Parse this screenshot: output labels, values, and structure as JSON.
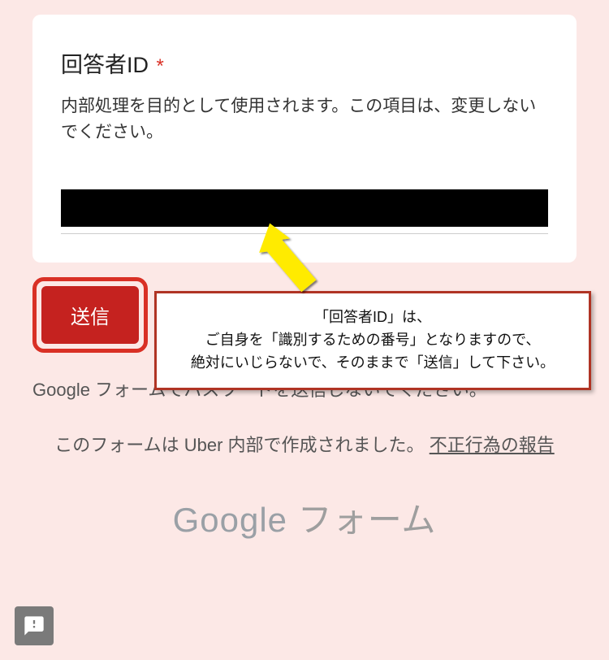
{
  "card": {
    "title": "回答者ID",
    "required_mark": "*",
    "description": "内部処理を目的として使用されます。この項目は、変更しないでください。"
  },
  "submit": {
    "label": "送信"
  },
  "callout": {
    "line1": "「回答者ID」は、",
    "line2": "ご自身を「識別するための番号」となりますので、",
    "line3": "絶対にいじらないで、そのままで「送信」して下さい。"
  },
  "footer": {
    "warning": "Google フォームでパスワードを送信しないでください。",
    "origin_prefix": "このフォームは Uber 内部で作成されました。",
    "report_link": "不正行為の報告",
    "logo_google": "Google",
    "logo_forms": " フォーム"
  }
}
